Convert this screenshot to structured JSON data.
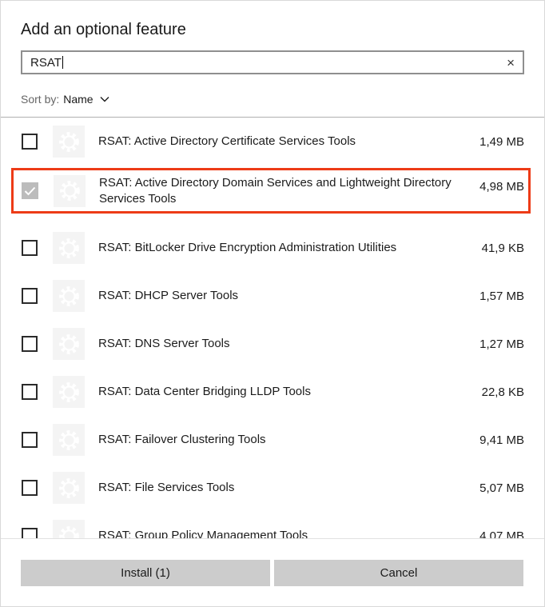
{
  "window": {
    "title": "Add an optional feature"
  },
  "search": {
    "value": "RSAT",
    "placeholder": "",
    "clear_icon": "×"
  },
  "sort": {
    "label": "Sort by:",
    "value": "Name"
  },
  "features": [
    {
      "name": "RSAT: Active Directory Certificate Services Tools",
      "size": "1,49 MB",
      "checked": false,
      "selected": false
    },
    {
      "name": "RSAT: Active Directory Domain Services and Lightweight Directory Services Tools",
      "size": "4,98 MB",
      "checked": true,
      "selected": true
    },
    {
      "name": "RSAT: BitLocker Drive Encryption Administration Utilities",
      "size": "41,9 KB",
      "checked": false,
      "selected": false
    },
    {
      "name": "RSAT: DHCP Server Tools",
      "size": "1,57 MB",
      "checked": false,
      "selected": false
    },
    {
      "name": "RSAT: DNS Server Tools",
      "size": "1,27 MB",
      "checked": false,
      "selected": false
    },
    {
      "name": "RSAT: Data Center Bridging LLDP Tools",
      "size": "22,8 KB",
      "checked": false,
      "selected": false
    },
    {
      "name": "RSAT: Failover Clustering Tools",
      "size": "9,41 MB",
      "checked": false,
      "selected": false
    },
    {
      "name": "RSAT: File Services Tools",
      "size": "5,07 MB",
      "checked": false,
      "selected": false
    },
    {
      "name": "RSAT: Group Policy Management Tools",
      "size": "4,07 MB",
      "checked": false,
      "selected": false
    }
  ],
  "footer": {
    "install_label": "Install (1)",
    "cancel_label": "Cancel"
  },
  "colors": {
    "selection_border": "#ed3b17",
    "button_bg": "#cccccc",
    "checked_checkbox_bg": "#bcbcbc",
    "tile_bg": "#f4f4f4",
    "header_divider": "#b0b0b0"
  }
}
